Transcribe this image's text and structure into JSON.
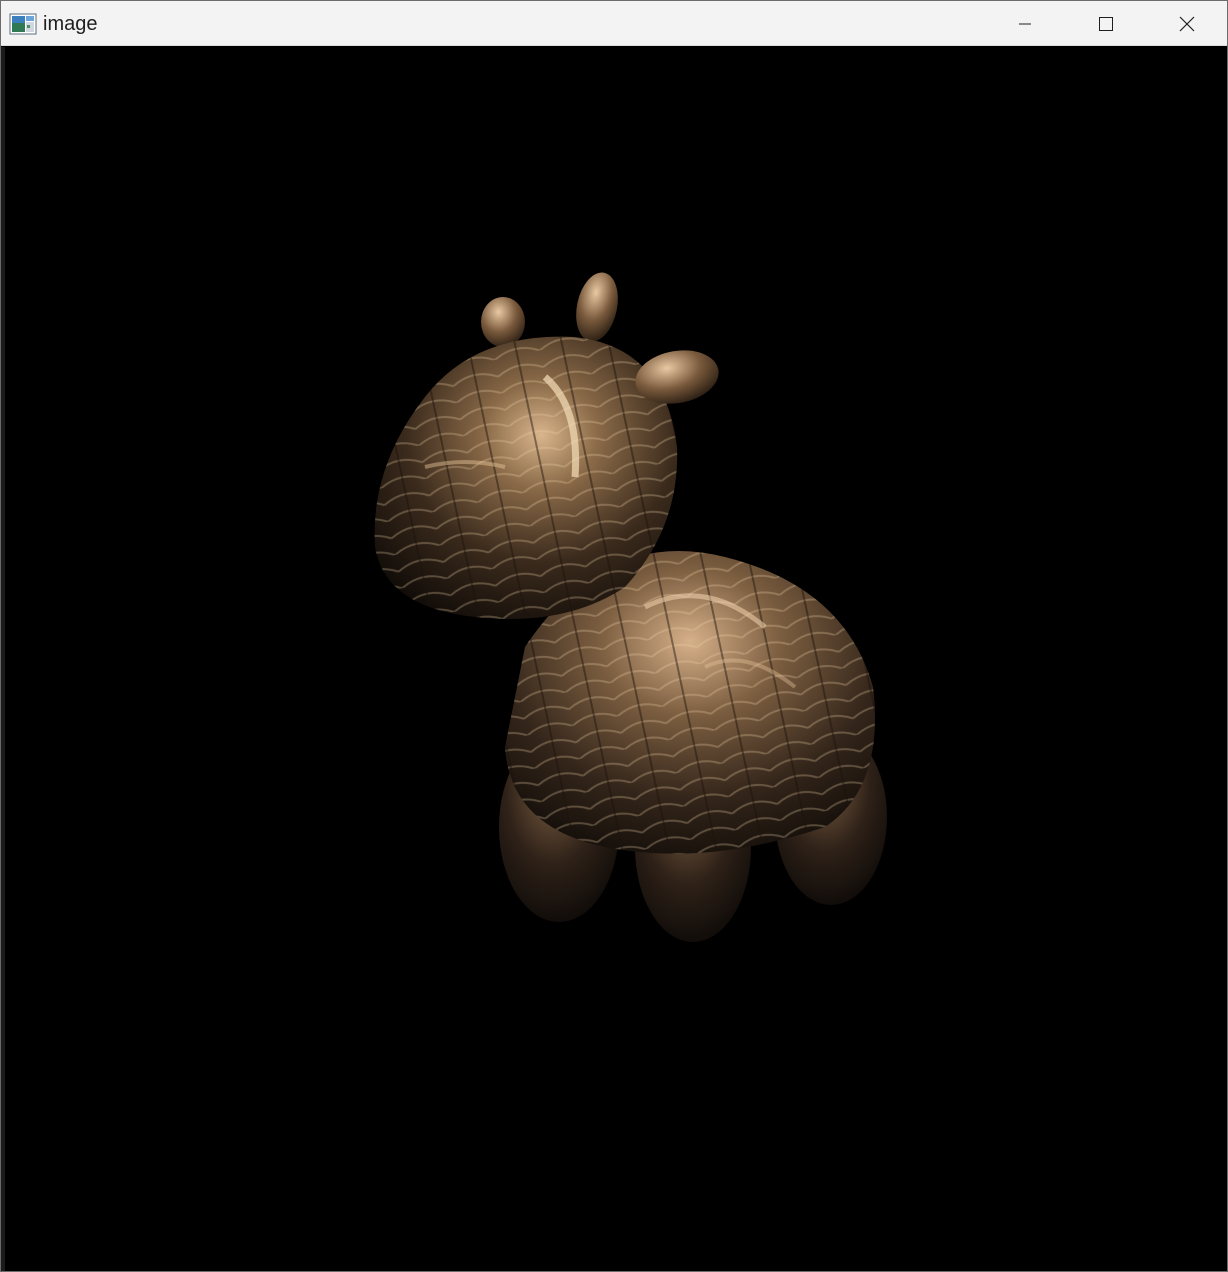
{
  "window": {
    "title": "image",
    "app_icon": "image-viewer-icon",
    "controls": {
      "minimize_icon": "minimize-icon",
      "maximize_icon": "maximize-icon",
      "close_icon": "close-icon"
    }
  },
  "scene": {
    "subject": "rendered-3d-cow-model",
    "background_color": "#000000",
    "material_color": "#c8a27a"
  }
}
